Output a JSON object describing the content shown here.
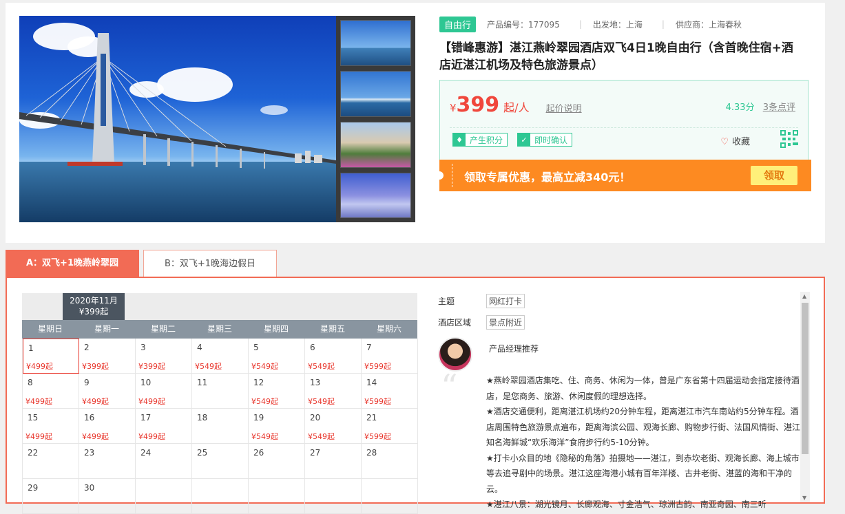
{
  "product": {
    "type_tag": "自由行",
    "code_label": "产品编号：177095",
    "departure_label": "出发地：上海",
    "supplier_label": "供应商：上海春秋",
    "title": "【错峰惠游】湛江燕岭翠园酒店双飞4日1晚自由行（含首晚住宿+酒店近湛江机场及特色旅游景点）"
  },
  "price": {
    "currency": "¥",
    "amount": "399",
    "unit": "起/人",
    "explain_link": "起价说明",
    "score": "4.33分",
    "reviews_link": "3条点评"
  },
  "badges": [
    {
      "icon": "gem-icon",
      "label": "产生积分"
    },
    {
      "icon": "check-icon",
      "label": "即时确认"
    }
  ],
  "favorite_label": "收藏",
  "promo": {
    "text": "领取专属优惠，最高立减340元！",
    "button": "领取"
  },
  "tabs": [
    {
      "label": "A：双飞+1晚燕岭翠园"
    },
    {
      "label": "B：双飞+1晚海边假日"
    }
  ],
  "calendar": {
    "month": "2020年11月",
    "month_price": "¥399起",
    "weekdays": [
      "星期日",
      "星期一",
      "星期二",
      "星期三",
      "星期四",
      "星期五",
      "星期六"
    ],
    "weeks": [
      [
        {
          "d": "1",
          "p": "¥499起"
        },
        {
          "d": "2",
          "p": "¥399起"
        },
        {
          "d": "3",
          "p": "¥399起"
        },
        {
          "d": "4",
          "p": "¥549起"
        },
        {
          "d": "5",
          "p": "¥549起"
        },
        {
          "d": "6",
          "p": "¥549起"
        },
        {
          "d": "7",
          "p": "¥599起"
        }
      ],
      [
        {
          "d": "8",
          "p": "¥499起"
        },
        {
          "d": "9",
          "p": "¥499起"
        },
        {
          "d": "10",
          "p": "¥499起"
        },
        {
          "d": "11",
          "p": ""
        },
        {
          "d": "12",
          "p": "¥549起"
        },
        {
          "d": "13",
          "p": "¥549起"
        },
        {
          "d": "14",
          "p": "¥599起"
        }
      ],
      [
        {
          "d": "15",
          "p": "¥499起"
        },
        {
          "d": "16",
          "p": "¥499起"
        },
        {
          "d": "17",
          "p": "¥499起"
        },
        {
          "d": "18",
          "p": ""
        },
        {
          "d": "19",
          "p": "¥549起"
        },
        {
          "d": "20",
          "p": "¥549起"
        },
        {
          "d": "21",
          "p": "¥599起"
        }
      ],
      [
        {
          "d": "22",
          "p": ""
        },
        {
          "d": "23",
          "p": ""
        },
        {
          "d": "24",
          "p": ""
        },
        {
          "d": "25",
          "p": ""
        },
        {
          "d": "26",
          "p": ""
        },
        {
          "d": "27",
          "p": ""
        },
        {
          "d": "28",
          "p": ""
        }
      ],
      [
        {
          "d": "29",
          "p": ""
        },
        {
          "d": "30",
          "p": ""
        },
        {
          "d": "",
          "p": ""
        },
        {
          "d": "",
          "p": ""
        },
        {
          "d": "",
          "p": ""
        },
        {
          "d": "",
          "p": ""
        },
        {
          "d": "",
          "p": ""
        }
      ]
    ]
  },
  "attributes": [
    {
      "key": "主题",
      "value": "网红打卡"
    },
    {
      "key": "酒店区域",
      "value": "景点附近"
    }
  ],
  "manager_label": "产品经理推荐",
  "description": [
    "★燕岭翠园酒店集吃、住、商务、休闲为一体，曾是广东省第十四届运动会指定接待酒店，是您商务、旅游、休闲度假的理想选择。",
    "★酒店交通便利，距离湛江机场约20分钟车程，距离湛江市汽车南站约5分钟车程。酒店周围特色旅游景点遍布，距离海滨公园、观海长廊、购物步行街、法国风情街、湛江知名海鲜城“欢乐海洋”食府步行约5-10分钟。",
    "★打卡小众目的地《隐秘的角落》拍摄地——湛江，到赤坎老街、观海长廊、海上城市等去追寻剧中的场景。湛江这座海港小城有百年洋楼、古井老街、湛蓝的海和干净的云。",
    "★湛江八景：湖光镜月、长廊观海、寸金浩气、琼洲古韵、南亚奇园、南三听"
  ]
}
